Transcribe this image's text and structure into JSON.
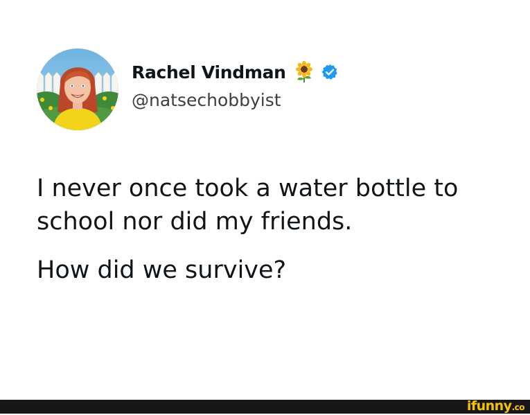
{
  "tweet": {
    "display_name": "Rachel Vindman",
    "handle": "@natsechobbyist",
    "name_emoji": "sunflower-icon",
    "verified_icon": "verified-badge-icon",
    "text_line_1": "I never once took a water bottle to school nor did my friends.",
    "text_line_2": "How did we survive?"
  },
  "watermark": {
    "brand": "ifunny",
    "suffix": ".co"
  },
  "colors": {
    "verified_blue": "#1d9bf0",
    "footer_bg": "#171717",
    "watermark_yellow": "#f4c20d",
    "text": "#0f1419"
  }
}
